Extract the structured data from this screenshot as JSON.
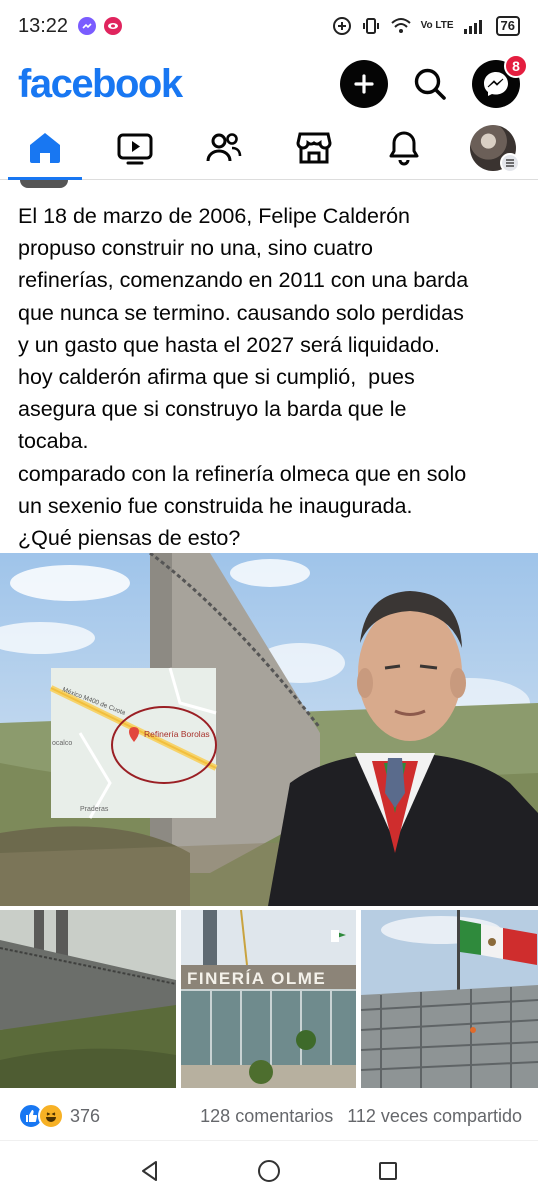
{
  "status_bar": {
    "time": "13:22",
    "battery": "76",
    "network": "Vo LTE",
    "icons": [
      "messenger-icon",
      "app-notification-icon",
      "data-saver-icon",
      "vibrate-icon",
      "wifi-icon",
      "signal-icon",
      "battery-icon"
    ]
  },
  "header": {
    "logo": "facebook",
    "messenger_badge": "8",
    "icons": [
      "plus-icon",
      "search-icon",
      "messenger-icon"
    ]
  },
  "tabs": [
    {
      "name": "home",
      "icon": "home-icon",
      "active": true
    },
    {
      "name": "video",
      "icon": "video-icon",
      "active": false
    },
    {
      "name": "friends",
      "icon": "friends-icon",
      "active": false
    },
    {
      "name": "marketplace",
      "icon": "marketplace-icon",
      "active": false
    },
    {
      "name": "notifications",
      "icon": "bell-icon",
      "active": false
    },
    {
      "name": "menu",
      "icon": "avatar-menu-icon",
      "active": false
    }
  ],
  "post": {
    "text": "El 18 de marzo de 2006, Felipe Calderón\npropuso construir no una, sino cuatro\nrefinerías, comenzando en 2011 con una barda\nque nunca se termino. causando solo perdidas\ny un gasto que hasta el 2027 será liquidado.\nhoy calderón afirma que si cumplió,  pues\nasegura que si construyo la barda que le\ntocaba.\ncomparado con la refinería olmeca que en solo\nun sexenio fue construida he inaugurada.\n¿Qué piensas de esto?",
    "map": {
      "road": "México M400 de Cuota",
      "place": "Refinería Borolas",
      "town_left": "ocalco",
      "town_bottom": "Praderas"
    },
    "sign_text": "FINERÍA OLME"
  },
  "reactions": {
    "count": "376",
    "comments": "128 comentarios",
    "shares": "112 veces compartido",
    "types": [
      "like",
      "haha"
    ]
  },
  "nav": {
    "buttons": [
      "back-icon",
      "home-icon",
      "recents-icon"
    ]
  },
  "colors": {
    "brand": "#1877f2",
    "badge": "#e41e3f",
    "text": "#050505",
    "secondary": "#65676b"
  }
}
